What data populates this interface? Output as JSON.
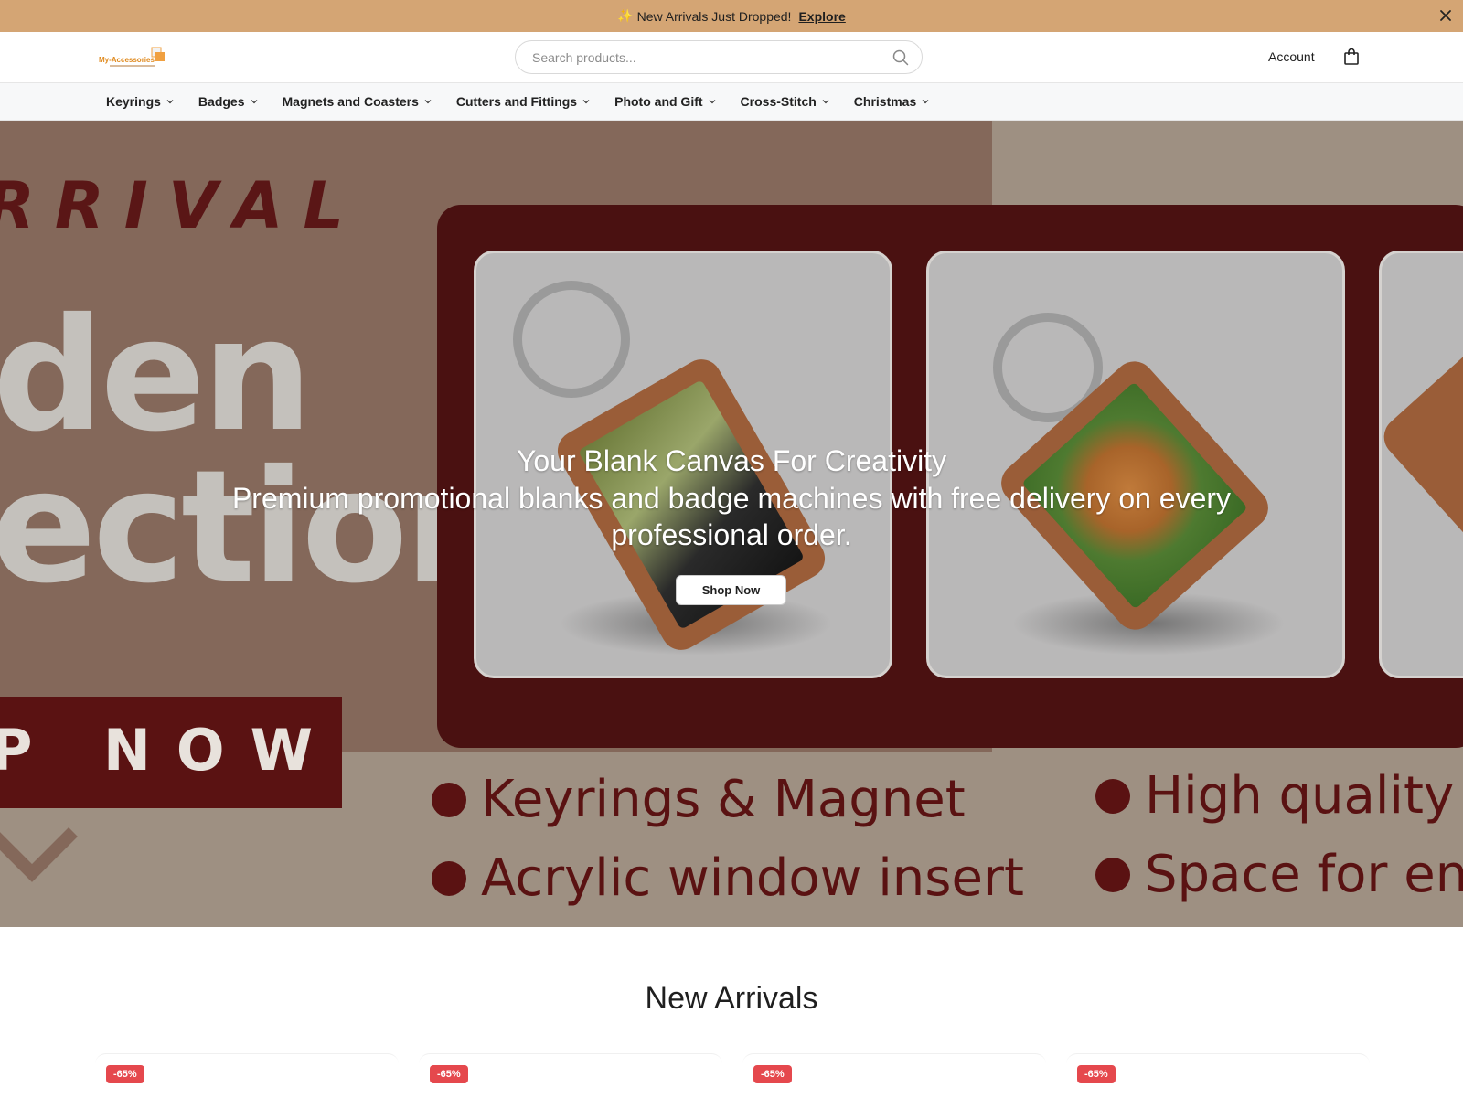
{
  "announcement": {
    "icon": "sparkles-icon",
    "text": "New Arrivals Just Dropped!",
    "link_label": "Explore",
    "close_icon": "close-icon"
  },
  "header": {
    "logo_text": "My-Accessories",
    "search_placeholder": "Search products...",
    "account_label": "Account",
    "cart_icon": "shopping-bag-icon"
  },
  "nav": {
    "items": [
      {
        "label": "Keyrings"
      },
      {
        "label": "Badges"
      },
      {
        "label": "Magnets and Coasters"
      },
      {
        "label": "Cutters and Fittings"
      },
      {
        "label": "Photo and Gift"
      },
      {
        "label": "Cross-Stitch"
      },
      {
        "label": "Christmas"
      }
    ]
  },
  "hero": {
    "banner_text": {
      "arrival": "RRIVAL",
      "line1": "den",
      "line2": "ection",
      "now": "P NOW",
      "bullets": [
        "Keyrings & Magnet",
        "Acrylic window insert",
        "High quality",
        "Space for en"
      ]
    },
    "heading": "Your Blank Canvas For Creativity",
    "subheading": "Premium promotional blanks and badge machines with free delivery on every professional order.",
    "cta_label": "Shop Now"
  },
  "new_arrivals": {
    "title": "New Arrivals",
    "products": [
      {
        "badge": "-65%"
      },
      {
        "badge": "-65%"
      },
      {
        "badge": "-65%"
      },
      {
        "badge": "-65%"
      }
    ]
  },
  "colors": {
    "announcement_bg": "#d4a574",
    "sale_badge": "#e5484d",
    "hero_maroon": "#4a1111"
  }
}
